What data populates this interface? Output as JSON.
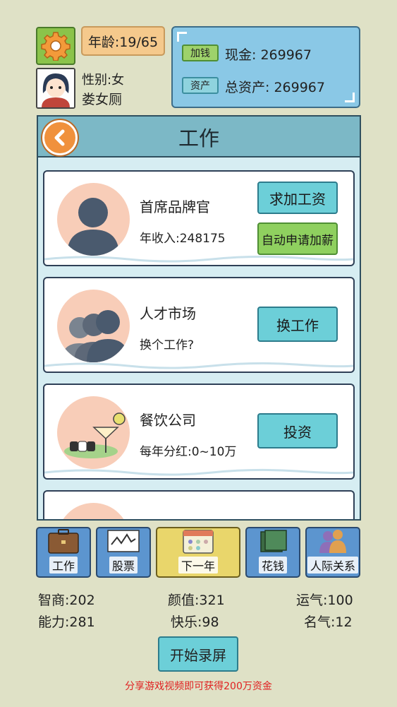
{
  "header": {
    "age_label": "年龄:19/65",
    "gender_label": "性别:女",
    "player_name": "娄女厕"
  },
  "money": {
    "add_money_label": "加钱",
    "cash_label": "现金: 269967",
    "assets_tag": "资产",
    "total_assets_label": "总资产: 269967"
  },
  "work_panel": {
    "title": "工作",
    "cards": [
      {
        "name": "首席品牌官",
        "sub": "年收入:248175",
        "btn1": "求加工资",
        "btn2": "自动申请加薪"
      },
      {
        "name": "人才市场",
        "sub": "换个工作?",
        "btn1": "换工作"
      },
      {
        "name": "餐饮公司",
        "sub": "每年分红:0~10万",
        "btn1": "投资"
      }
    ]
  },
  "nav": [
    {
      "label": "工作",
      "icon": "briefcase-icon"
    },
    {
      "label": "股票",
      "icon": "stock-chart-icon"
    },
    {
      "label": "下一年",
      "icon": "calendar-icon"
    },
    {
      "label": "花钱",
      "icon": "money-stack-icon"
    },
    {
      "label": "人际关系",
      "icon": "people-icon"
    }
  ],
  "stats": {
    "iq": "智商:202",
    "looks": "颜值:321",
    "luck": "运气:100",
    "ability": "能力:281",
    "happiness": "快乐:98",
    "fame": "名气:12"
  },
  "record_button": "开始录屏",
  "share_text": "分享游戏视频即可获得200万资金",
  "colors": {
    "background": "#dfe1c6",
    "panel_blue": "#8ac8e6",
    "button_cyan": "#6ccfd8",
    "button_green": "#8fd05f",
    "share_red": "#e02020"
  }
}
